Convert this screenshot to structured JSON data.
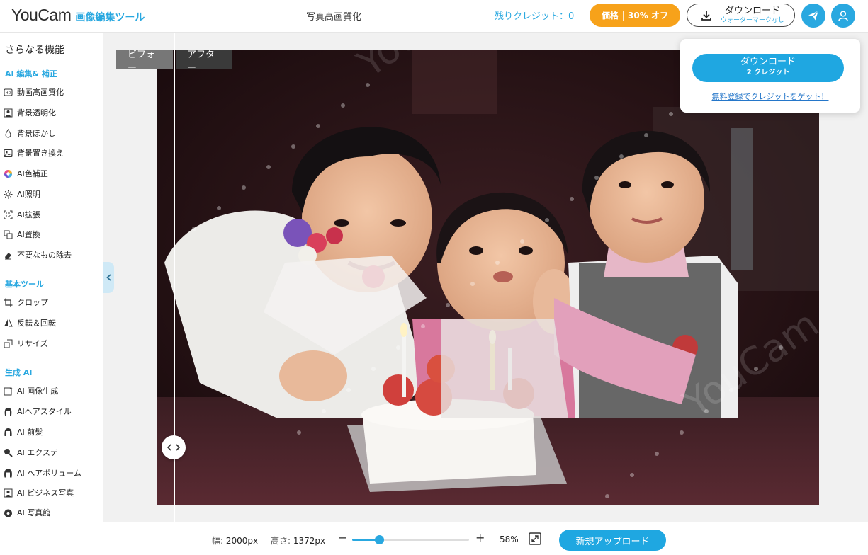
{
  "header": {
    "logo_main": "YouCam",
    "logo_sub": "画像編集ツール",
    "page_title": "写真高画質化",
    "credits_label": "残りクレジット：0",
    "price_label": "価格",
    "price_discount": "30% オフ",
    "download_label": "ダウンロード",
    "download_sub": "ウォーターマークなし"
  },
  "sidebar": {
    "heading": "さらなる機能",
    "sections": [
      {
        "title": "AI 編集& 補正",
        "items": [
          {
            "label": "動画高画質化",
            "icon": "hd-video-icon"
          },
          {
            "label": "背景透明化",
            "icon": "person-cutout-icon"
          },
          {
            "label": "背景ぼかし",
            "icon": "drop-icon"
          },
          {
            "label": "背景置き換え",
            "icon": "image-icon"
          },
          {
            "label": "AI色補正",
            "icon": "color-wheel-icon"
          },
          {
            "label": "AI照明",
            "icon": "sun-icon"
          },
          {
            "label": "AI拡張",
            "icon": "expand-icon"
          },
          {
            "label": "AI置換",
            "icon": "replace-icon"
          },
          {
            "label": "不要なもの除去",
            "icon": "eraser-icon"
          }
        ]
      },
      {
        "title": "基本ツール",
        "items": [
          {
            "label": "クロップ",
            "icon": "crop-icon"
          },
          {
            "label": "反転＆回転",
            "icon": "flip-icon"
          },
          {
            "label": "リサイズ",
            "icon": "resize-icon"
          }
        ]
      },
      {
        "title": "生成 AI",
        "items": [
          {
            "label": "AI 画像生成",
            "icon": "ai-image-icon"
          },
          {
            "label": "AIヘアスタイル",
            "icon": "hair-icon"
          },
          {
            "label": "AI 前髪",
            "icon": "bangs-icon"
          },
          {
            "label": "AI エクステ",
            "icon": "extension-icon"
          },
          {
            "label": "AI ヘアボリューム",
            "icon": "volume-icon"
          },
          {
            "label": "AI ビジネス写真",
            "icon": "portrait-icon"
          },
          {
            "label": "AI 写真館",
            "icon": "studio-icon"
          }
        ]
      }
    ]
  },
  "canvas": {
    "before_label": "ビフォー",
    "after_label": "アフター",
    "split_position": 0.025,
    "watermark_text": "YouCam"
  },
  "popup": {
    "button_label": "ダウンロード",
    "button_sub": "2 クレジット",
    "link": "無料登録でクレジットをゲット！"
  },
  "bottom": {
    "width_label": "幅:",
    "width_value": "2000px",
    "height_label": "高さ:",
    "height_value": "1372px",
    "zoom_minus": "−",
    "zoom_plus": "+",
    "zoom_value": 0.23,
    "zoom_pct": "58%",
    "upload_label": "新規アップロード"
  },
  "colors": {
    "accent": "#29a8e0",
    "price": "#f7a21a"
  }
}
